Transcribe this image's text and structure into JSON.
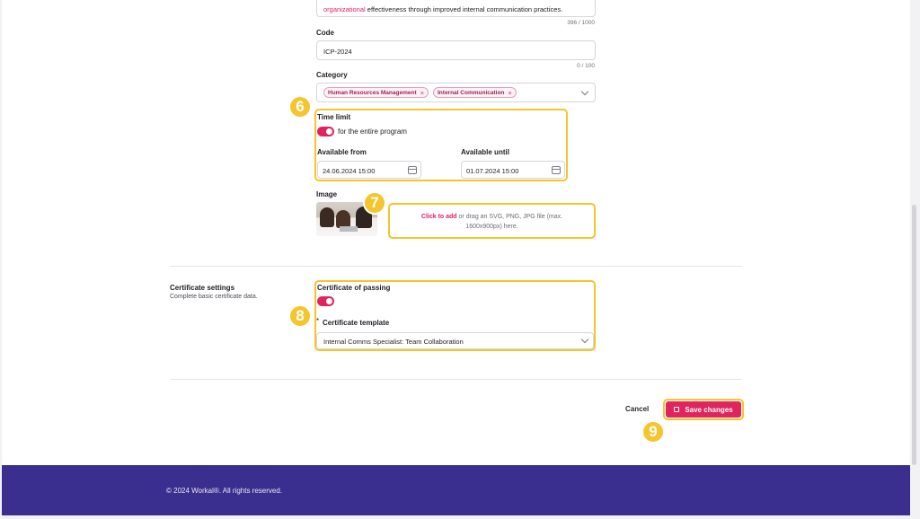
{
  "description": {
    "text_prefix": "",
    "highlight_word": "organizational",
    "text_suffix": " effectiveness through improved internal communication practices.",
    "counter": "396 / 1000"
  },
  "code": {
    "label": "Code",
    "value": "ICP-2024",
    "counter": "0 / 100"
  },
  "category": {
    "label": "Category",
    "chips": [
      "Human Resources Management",
      "Internal Communication"
    ],
    "remove_glyph": "×"
  },
  "time_limit": {
    "label": "Time limit",
    "toggle_on": true,
    "toggle_label": "for the entire program",
    "from_label": "Available from",
    "from_value": "24.06.2024 15:00",
    "until_label": "Available until",
    "until_value": "01.07.2024 15:00"
  },
  "image": {
    "label": "Image",
    "dropzone_link": "Click to add",
    "dropzone_text_1": " or drag an SVG, PNG, JPG file (max.",
    "dropzone_text_2": "1600x900px) here."
  },
  "certificate": {
    "section_title": "Certificate settings",
    "section_desc": "Complete basic certificate data.",
    "passing_label": "Certificate of passing",
    "passing_on": true,
    "required_mark": "*",
    "template_label": "Certificate template",
    "template_value": "Internal Comms Specialist: Team Collaboration"
  },
  "actions": {
    "cancel": "Cancel",
    "save": "Save changes"
  },
  "badges": [
    "6",
    "7",
    "8",
    "9"
  ],
  "footer": {
    "copyright": "© 2024 Workal®. All rights reserved."
  },
  "colors": {
    "accent": "#e0245e",
    "highlight": "#f5c52b",
    "footer_bg": "#3a2f8f"
  },
  "icons": [
    "calendar-icon",
    "chevron-down-icon",
    "close-icon",
    "save-icon"
  ]
}
